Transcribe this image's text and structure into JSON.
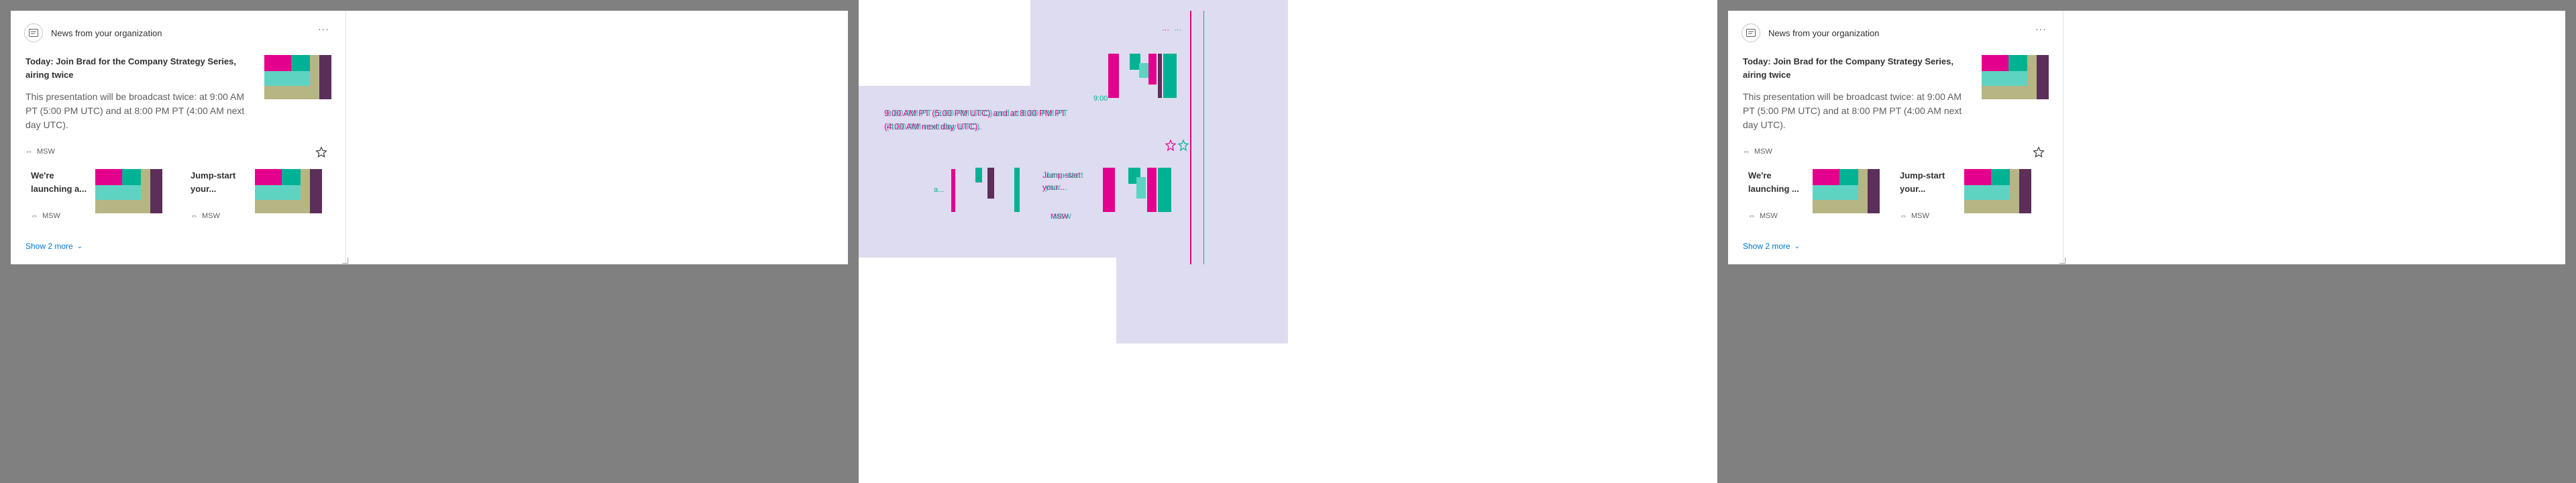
{
  "panels": {
    "left": {
      "header": {
        "title": "News from your organization",
        "icon": "news-icon",
        "more": "···"
      },
      "featured": {
        "title": "Today: Join Brad for the Company Strategy Series, airing twice",
        "description": "This presentation will be broadcast twice: at 9:00 AM PT (5:00 PM UTC) and at 8:00 PM PT (4:00 AM next day UTC).",
        "source": "MSW"
      },
      "items": [
        {
          "title": "We're launching a...",
          "source": "MSW"
        },
        {
          "title": "Jump-start your...",
          "source": "MSW"
        }
      ],
      "show_more": "Show 2 more"
    },
    "right": {
      "header": {
        "title": "News from your organization",
        "icon": "news-icon",
        "more": "···"
      },
      "featured": {
        "title": "Today: Join Brad for the Company Strategy Series, airing twice",
        "description": "This presentation will be broadcast twice: at 9:00 AM PT (5:00 PM UTC) and at 8:00 PM PT (4:00 AM next day UTC).",
        "source": "MSW"
      },
      "items": [
        {
          "title": "We're launching ...",
          "source": "MSW"
        },
        {
          "title": "Jump-start your...",
          "source": "MSW"
        }
      ],
      "show_more": "Show 2 more"
    },
    "diff": {
      "line_1": "9:00 AM PT (5:00 PM UTC) and at 8:00 PM PT",
      "line_2": "(4:00 AM next day UTC).",
      "snippet_a": "9:00",
      "item_title": "Jump-start your...",
      "item_source": "MSW",
      "more": "···",
      "dot": "a..."
    }
  },
  "colors": {
    "magenta": "#e3008c",
    "teal": "#00b294",
    "teal_light": "#5fd3c2",
    "khaki": "#b6b584",
    "plum": "#5c2e5a",
    "link": "#0078d4",
    "diff_bg": "#dedcf0"
  }
}
